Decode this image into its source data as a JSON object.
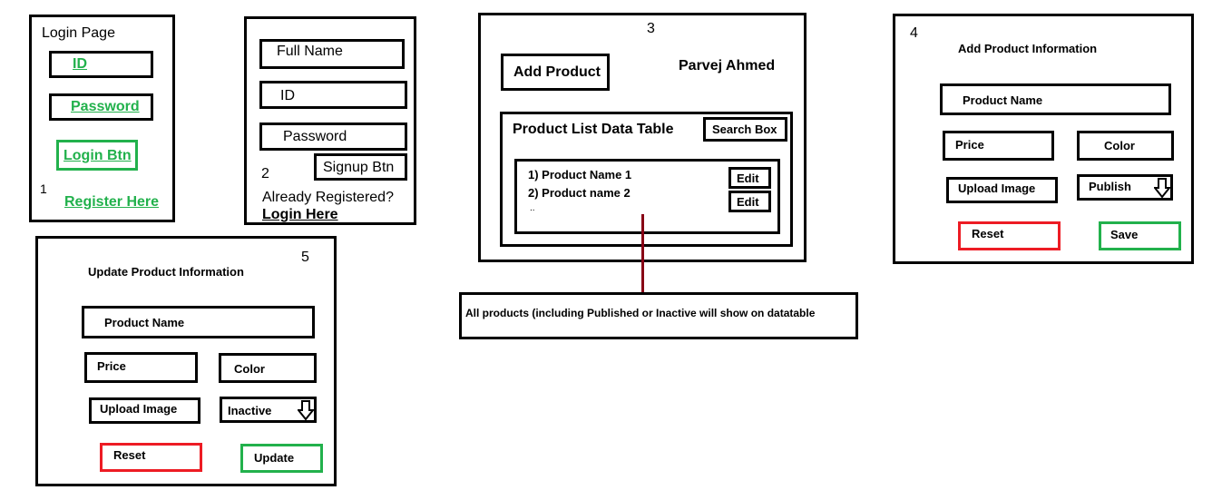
{
  "login": {
    "title": "Login Page",
    "id_field": "ID",
    "password_field": "Password",
    "login_btn": "Login Btn",
    "number": "1",
    "register_link": "Register Here"
  },
  "signup": {
    "fullname_field": "Full Name",
    "id_field": "ID",
    "password_field": "Password",
    "signup_btn": "Signup Btn",
    "number": "2",
    "already_text": "Already Registered?",
    "login_link": "Login Here"
  },
  "dashboard": {
    "number": "3",
    "add_product_btn": "Add Product",
    "user_name": "Parvej Ahmed",
    "table_title": "Product List Data Table",
    "search_box": "Search Box",
    "rows": [
      {
        "label": "1) Product Name 1",
        "edit": "Edit"
      },
      {
        "label": "2) Product name 2",
        "edit": "Edit"
      }
    ],
    "ellipsis": ".."
  },
  "note": {
    "text": "All products (including Published or Inactive will show on datatable"
  },
  "add_form": {
    "number": "4",
    "title": "Add Product Information",
    "product_name": "Product Name",
    "price": "Price",
    "color": "Color",
    "upload_image": "Upload Image",
    "status": "Publish",
    "reset_btn": "Reset",
    "save_btn": "Save"
  },
  "update_form": {
    "number": "5",
    "title": "Update Product Information",
    "product_name": "Product Name",
    "price": "Price",
    "color": "Color",
    "upload_image": "Upload Image",
    "status": "Inactive",
    "reset_btn": "Reset",
    "update_btn": "Update"
  },
  "colors": {
    "green": "#22b14c",
    "red": "#ed1c24",
    "connector": "#880015"
  },
  "icons": [
    "down-arrow-icon"
  ]
}
